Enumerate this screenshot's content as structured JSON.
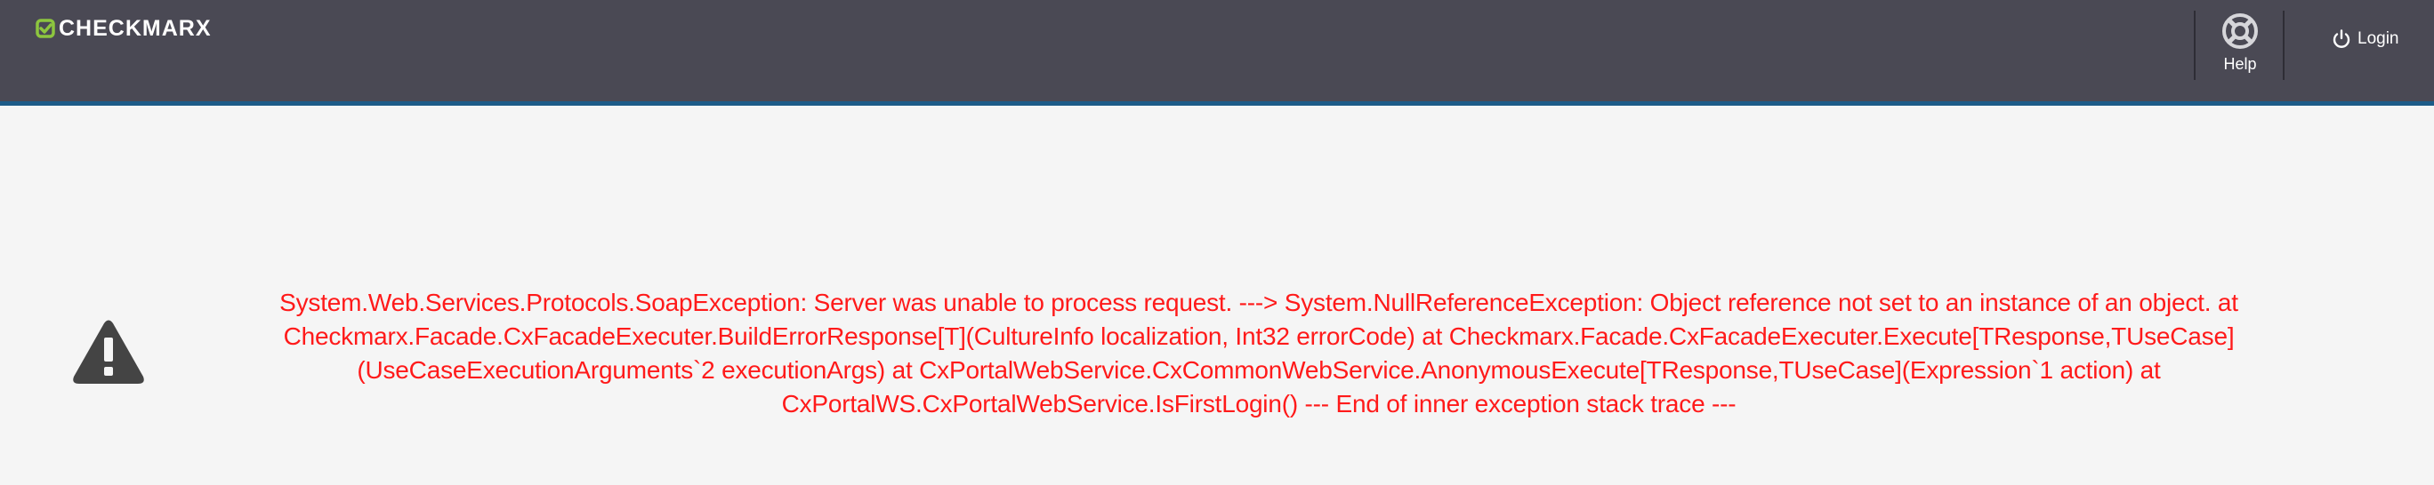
{
  "header": {
    "logo_text": "CHECKMARX",
    "help_label": "Help",
    "login_label": "Login",
    "colors": {
      "bar": "#4a4954",
      "accent_line": "#1d5b88",
      "logo_mark": "#8dc63f"
    },
    "icons": {
      "logo": "checkmark-logo-icon",
      "help": "lifebuoy-icon",
      "login": "power-icon"
    }
  },
  "main": {
    "warning_icon": "warning-triangle-icon",
    "error_color": "#ff1a1a",
    "error_message": "System.Web.Services.Protocols.SoapException: Server was unable to process request. ---> System.NullReferenceException: Object reference not set to an instance of an object. at Checkmarx.Facade.CxFacadeExecuter.BuildErrorResponse[T](CultureInfo localization, Int32 errorCode) at Checkmarx.Facade.CxFacadeExecuter.Execute[TResponse,TUseCase](UseCaseExecutionArguments`2 executionArgs) at CxPortalWebService.CxCommonWebService.AnonymousExecute[TResponse,TUseCase](Expression`1 action) at CxPortalWS.CxPortalWebService.IsFirstLogin() --- End of inner exception stack trace ---"
  }
}
